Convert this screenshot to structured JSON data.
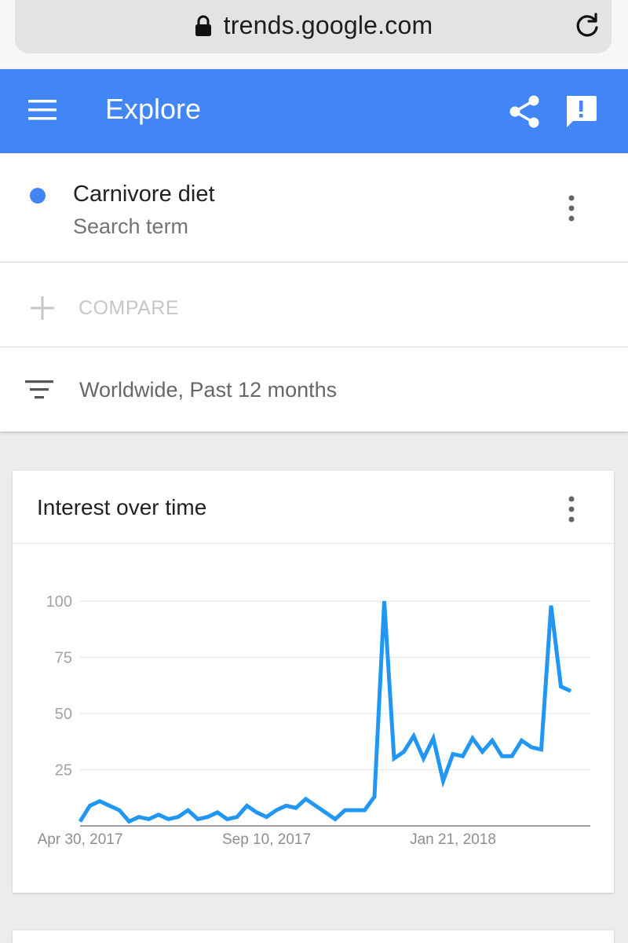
{
  "browser": {
    "url": "trends.google.com",
    "lock_icon": "lock-icon",
    "reload_icon": "reload-icon"
  },
  "appbar": {
    "title": "Explore",
    "menu_icon": "menu-icon",
    "share_icon": "share-icon",
    "feedback_icon": "feedback-icon",
    "color": "#4285f4"
  },
  "search_term": {
    "name": "Carnivore diet",
    "type": "Search term",
    "color": "#4285f4"
  },
  "compare": {
    "label": "COMPARE"
  },
  "filters": {
    "text": "Worldwide, Past 12 months"
  },
  "card": {
    "title": "Interest over time"
  },
  "chart_data": {
    "type": "line",
    "title": "Interest over time",
    "xlabel": "",
    "ylabel": "",
    "ylim": [
      0,
      100
    ],
    "yticks": [
      "100",
      "75",
      "50",
      "25"
    ],
    "xtick_labels": [
      "Apr 30, 2017",
      "Sep 10, 2017",
      "Jan 21, 2018"
    ],
    "grid": true,
    "color": "#2196f3",
    "x": [
      "2017-04-30",
      "2017-05-07",
      "2017-05-14",
      "2017-05-21",
      "2017-05-28",
      "2017-06-04",
      "2017-06-11",
      "2017-06-18",
      "2017-06-25",
      "2017-07-02",
      "2017-07-09",
      "2017-07-16",
      "2017-07-23",
      "2017-07-30",
      "2017-08-06",
      "2017-08-13",
      "2017-08-20",
      "2017-08-27",
      "2017-09-03",
      "2017-09-10",
      "2017-09-17",
      "2017-09-24",
      "2017-10-01",
      "2017-10-08",
      "2017-10-15",
      "2017-10-22",
      "2017-10-29",
      "2017-11-05",
      "2017-11-12",
      "2017-11-19",
      "2017-11-26",
      "2017-12-03",
      "2017-12-10",
      "2017-12-17",
      "2017-12-24",
      "2017-12-31",
      "2018-01-07",
      "2018-01-14",
      "2018-01-21",
      "2018-01-28",
      "2018-02-04",
      "2018-02-11",
      "2018-02-18",
      "2018-02-25",
      "2018-03-04",
      "2018-03-11",
      "2018-03-18",
      "2018-03-25",
      "2018-04-01",
      "2018-04-08",
      "2018-04-15",
      "2018-04-22",
      "2018-04-29"
    ],
    "values": [
      2,
      9,
      11,
      9,
      7,
      2,
      4,
      3,
      5,
      3,
      4,
      7,
      3,
      4,
      6,
      3,
      4,
      9,
      6,
      4,
      7,
      9,
      8,
      12,
      9,
      6,
      3,
      7,
      7,
      7,
      13,
      100,
      30,
      33,
      40,
      30,
      39,
      20,
      32,
      31,
      39,
      33,
      38,
      31,
      31,
      38,
      35,
      34,
      98,
      62,
      60
    ]
  }
}
